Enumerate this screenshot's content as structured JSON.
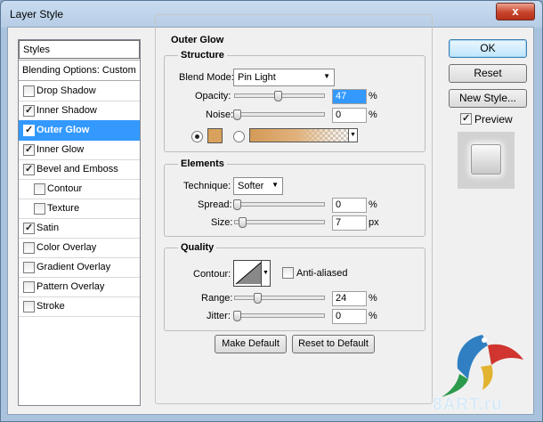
{
  "window": {
    "title": "Layer Style",
    "close_glyph": "x"
  },
  "styles_list": {
    "header": "Styles",
    "blending_options": "Blending Options: Custom",
    "items": [
      {
        "label": "Drop Shadow",
        "checked": false,
        "selected": false,
        "indent": false
      },
      {
        "label": "Inner Shadow",
        "checked": true,
        "selected": false,
        "indent": false
      },
      {
        "label": "Outer Glow",
        "checked": true,
        "selected": true,
        "indent": false
      },
      {
        "label": "Inner Glow",
        "checked": true,
        "selected": false,
        "indent": false
      },
      {
        "label": "Bevel and Emboss",
        "checked": true,
        "selected": false,
        "indent": false
      },
      {
        "label": "Contour",
        "checked": false,
        "selected": false,
        "indent": true
      },
      {
        "label": "Texture",
        "checked": false,
        "selected": false,
        "indent": true
      },
      {
        "label": "Satin",
        "checked": true,
        "selected": false,
        "indent": false
      },
      {
        "label": "Color Overlay",
        "checked": false,
        "selected": false,
        "indent": false
      },
      {
        "label": "Gradient Overlay",
        "checked": false,
        "selected": false,
        "indent": false
      },
      {
        "label": "Pattern Overlay",
        "checked": false,
        "selected": false,
        "indent": false
      },
      {
        "label": "Stroke",
        "checked": false,
        "selected": false,
        "indent": false
      }
    ]
  },
  "panel": {
    "title": "Outer Glow",
    "structure": {
      "title": "Structure",
      "blend_mode_label": "Blend Mode:",
      "blend_mode_value": "Pin Light",
      "opacity_label": "Opacity:",
      "opacity_value": "47",
      "opacity_unit": "%",
      "noise_label": "Noise:",
      "noise_value": "0",
      "noise_unit": "%",
      "glow_color": "#d9a25c",
      "color_mode_selected": "solid"
    },
    "elements": {
      "title": "Elements",
      "technique_label": "Technique:",
      "technique_value": "Softer",
      "spread_label": "Spread:",
      "spread_value": "0",
      "spread_unit": "%",
      "size_label": "Size:",
      "size_value": "7",
      "size_unit": "px"
    },
    "quality": {
      "title": "Quality",
      "contour_label": "Contour:",
      "anti_aliased_label": "Anti-aliased",
      "anti_aliased_checked": false,
      "range_label": "Range:",
      "range_value": "24",
      "range_unit": "%",
      "jitter_label": "Jitter:",
      "jitter_value": "0",
      "jitter_unit": "%"
    },
    "make_default": "Make Default",
    "reset_to_default": "Reset to Default"
  },
  "buttons": {
    "ok": "OK",
    "reset": "Reset",
    "new_style": "New Style...",
    "preview_label": "Preview",
    "preview_checked": true
  },
  "watermark": "8ART.ru",
  "colors": {
    "selection": "#3399ff",
    "glow": "#d9a25c"
  }
}
